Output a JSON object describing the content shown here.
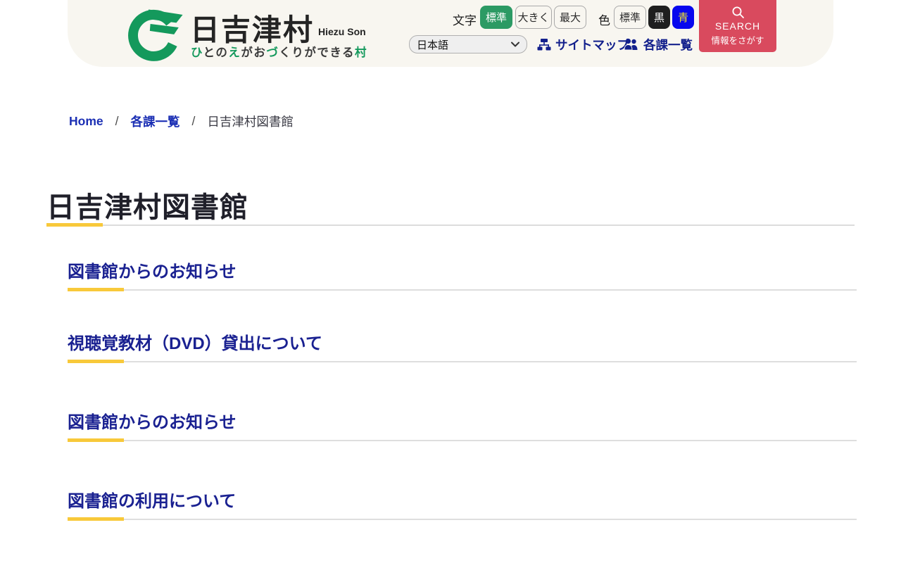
{
  "colors": {
    "accent_green": "#14995c",
    "button_green": "#2c9a64",
    "search_red": "#d94a5e",
    "heading_navy": "#1a2191",
    "nav_navy": "#13208c",
    "link_blue": "#1b2fb4",
    "underline_yellow": "#f8c93a",
    "header_cream": "#f8f6f0",
    "black_button": "#1f1f1f",
    "blue_button": "#0707ee",
    "blue_button_text": "#f3e32a"
  },
  "header": {
    "logo": {
      "title": "日吉津村",
      "subtitle": "Hiezu Son",
      "tagline": [
        {
          "text": "ひ",
          "accent": true
        },
        {
          "text": "との",
          "accent": false
        },
        {
          "text": "え",
          "accent": true
        },
        {
          "text": "がお",
          "accent": false
        },
        {
          "text": "づ",
          "accent": true
        },
        {
          "text": "くりができる",
          "accent": false
        },
        {
          "text": "村",
          "accent": true
        }
      ]
    },
    "font_size": {
      "label": "文字",
      "options": [
        {
          "label": "標準",
          "active": true
        },
        {
          "label": "大きく",
          "active": false
        },
        {
          "label": "最大",
          "active": false
        }
      ]
    },
    "color_scheme": {
      "label": "色",
      "options": [
        {
          "label": "標準",
          "style": "default"
        },
        {
          "label": "黒",
          "style": "black"
        },
        {
          "label": "青",
          "style": "blue"
        }
      ]
    },
    "language_select": {
      "value": "日本語"
    },
    "nav": [
      {
        "label": "サイトマップ",
        "icon": "sitemap-icon"
      },
      {
        "label": "各課一覧",
        "icon": "people-icon"
      }
    ],
    "search": {
      "line1": "SEARCH",
      "line2": "情報をさがす"
    }
  },
  "breadcrumb": {
    "separator": "/",
    "items": [
      {
        "label": "Home",
        "link": true
      },
      {
        "label": "各課一覧",
        "link": true
      },
      {
        "label": "日吉津村図書館",
        "link": false
      }
    ]
  },
  "page": {
    "title": "日吉津村図書館"
  },
  "sections": [
    {
      "title": "図書館からのお知らせ"
    },
    {
      "title": "視聴覚教材（DVD）貸出について"
    },
    {
      "title": "図書館からのお知らせ"
    },
    {
      "title": "図書館の利用について"
    }
  ]
}
